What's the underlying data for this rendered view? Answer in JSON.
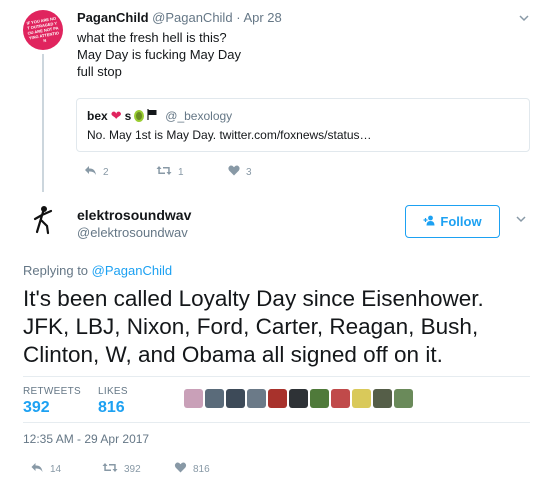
{
  "parent_tweet": {
    "avatar_text": "IF YOU ARE NOT OUTRAGED YOU ARE NOT PAYING ATTENTION",
    "display_name": "PaganChild",
    "handle": "@PaganChild",
    "separator": "·",
    "date": "Apr 28",
    "lines": [
      "what the fresh hell is this?",
      "May Day is fucking May Day",
      "full stop"
    ],
    "quote": {
      "display_name": "bex",
      "emoji_heart": "❤",
      "name_suffix": "s",
      "handle": "@_bexology",
      "text": "No. May 1st is May Day. twitter.com/foxnews/status…"
    },
    "actions": {
      "replies": "2",
      "retweets": "1",
      "likes": "3"
    }
  },
  "main_tweet": {
    "display_name": "elektrosoundwav",
    "handle": "@elektrosoundwav",
    "follow_label": "Follow",
    "follow_icon": "+",
    "replying_prefix": "Replying to",
    "replying_handle": "@PaganChild",
    "lines": [
      "It's been called Loyalty Day since Eisenhower.",
      "JFK, LBJ, Nixon, Ford, Carter, Reagan, Bush,",
      "Clinton, W, and Obama all signed off on it."
    ],
    "stats": {
      "retweets_label": "RETWEETS",
      "retweets_value": "392",
      "likes_label": "LIKES",
      "likes_value": "816"
    },
    "liker_colors": [
      "#c9a0b8",
      "#5a6b7a",
      "#3d4a58",
      "#6b7a88",
      "#a8322c",
      "#2e3236",
      "#4f7a3a",
      "#c04a4a",
      "#d9c95a",
      "#555e48",
      "#6a8a5a"
    ],
    "timestamp": "12:35 AM - 29 Apr 2017",
    "actions": {
      "replies": "14",
      "retweets": "392",
      "likes": "816"
    }
  },
  "icons": {
    "reply": "reply-icon",
    "retweet": "retweet-icon",
    "like": "heart-icon",
    "caret": "chevron-down-icon",
    "follow": "add-person-icon"
  }
}
